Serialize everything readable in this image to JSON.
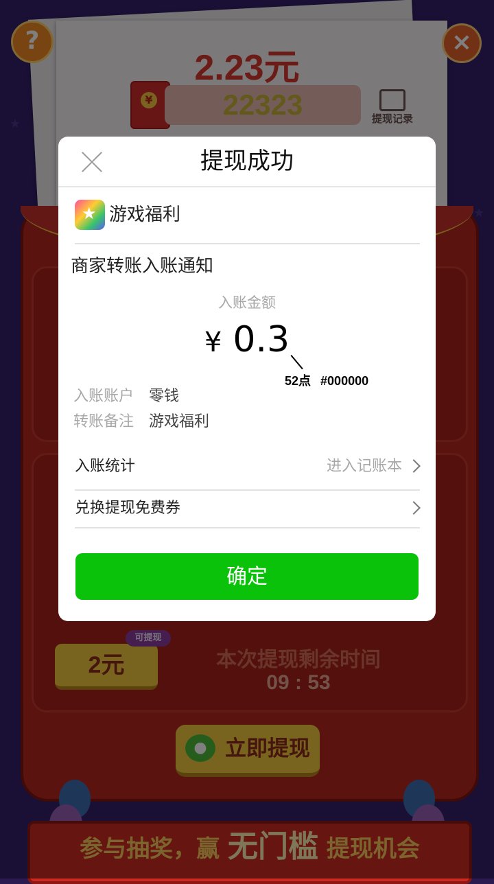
{
  "background": {
    "amount": "2.23元",
    "coins": "22323",
    "record_label": "提现记录",
    "help_icon": "question-mark-icon",
    "close_icon": "close-icon",
    "withdraw_option": "2元",
    "withdraw_tag": "可提现",
    "remaining_label": "本次提现剩余时间",
    "remaining_time": "09 : 53",
    "withdraw_now": "立即提现",
    "banner_prefix": "参与抽奖，赢",
    "banner_highlight": "无门槛",
    "banner_suffix": "提现机会"
  },
  "dialog": {
    "title": "提现成功",
    "app_name": "游戏福利",
    "notice": "商家转账入账通知",
    "amount_label": "入账金额",
    "currency": "¥",
    "amount": "0.3",
    "annotation_size": "52点",
    "annotation_color": "#000000",
    "account_label": "入账账户",
    "account_value": "零钱",
    "remark_label": "转账备注",
    "remark_value": "游戏福利",
    "stats_label": "入账统计",
    "stats_link": "进入记账本",
    "coupon_label": "兑换提现免费券",
    "confirm_label": "确定"
  },
  "colors": {
    "confirm_green": "#0ac20a",
    "amount_red": "#d8382f"
  }
}
